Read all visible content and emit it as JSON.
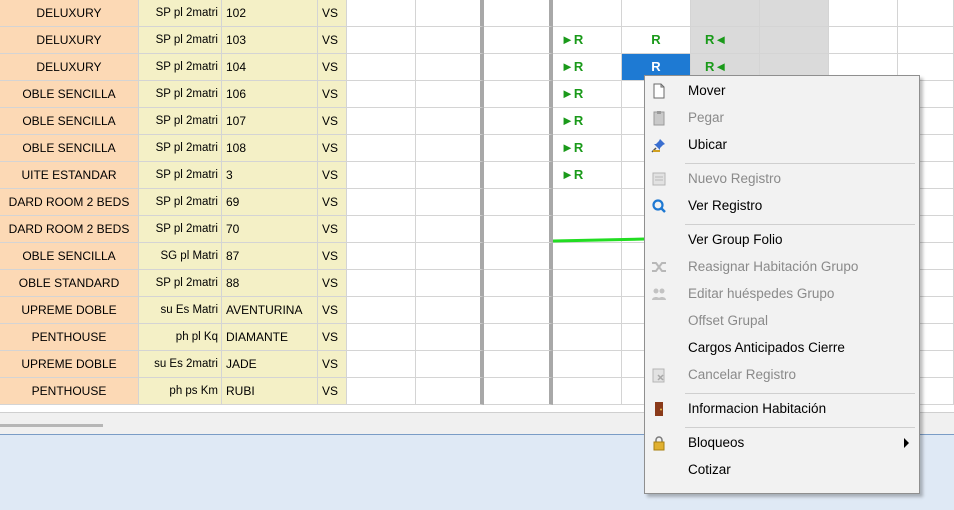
{
  "rows": [
    {
      "type": "DELUXURY",
      "plan": "SP pl 2matri",
      "room": "102",
      "status": "VS",
      "marks": []
    },
    {
      "type": "DELUXURY",
      "plan": "SP pl 2matri",
      "room": "103",
      "status": "VS",
      "marks": [
        {
          "col": 0,
          "text": "►R"
        },
        {
          "col": 1,
          "text": "R"
        },
        {
          "col": 2,
          "text": "R◄"
        }
      ]
    },
    {
      "type": "DELUXURY",
      "plan": "SP pl 2matri",
      "room": "104",
      "status": "VS",
      "marks": [
        {
          "col": 0,
          "text": "►R"
        },
        {
          "col": 1,
          "text": "R",
          "selected": true
        },
        {
          "col": 2,
          "text": "R◄"
        }
      ]
    },
    {
      "type": "OBLE SENCILLA",
      "plan": "SP pl 2matri",
      "room": "106",
      "status": "VS",
      "marks": [
        {
          "col": 0,
          "text": "►R"
        }
      ]
    },
    {
      "type": "OBLE SENCILLA",
      "plan": "SP pl 2matri",
      "room": "107",
      "status": "VS",
      "marks": [
        {
          "col": 0,
          "text": "►R"
        }
      ]
    },
    {
      "type": "OBLE SENCILLA",
      "plan": "SP pl 2matri",
      "room": "108",
      "status": "VS",
      "marks": [
        {
          "col": 0,
          "text": "►R"
        }
      ]
    },
    {
      "type": "UITE ESTANDAR",
      "plan": "SP pl 2matri",
      "room": "3",
      "status": "VS",
      "marks": [
        {
          "col": 0,
          "text": "►R"
        }
      ]
    },
    {
      "type": "DARD ROOM 2 BEDS",
      "plan": "SP pl 2matri",
      "room": "69",
      "status": "VS",
      "marks": []
    },
    {
      "type": "DARD ROOM 2 BEDS",
      "plan": "SP pl 2matri",
      "room": "70",
      "status": "VS",
      "marks": []
    },
    {
      "type": "OBLE SENCILLA",
      "plan": "SG pl Matri",
      "room": "87",
      "status": "VS",
      "marks": []
    },
    {
      "type": "OBLE STANDARD",
      "plan": "SP pl 2matri",
      "room": "88",
      "status": "VS",
      "marks": []
    },
    {
      "type": "UPREME DOBLE",
      "plan": "su Es Matri",
      "room": "AVENTURINA",
      "status": "VS",
      "marks": []
    },
    {
      "type": "PENTHOUSE",
      "plan": "ph pl Kq",
      "room": "DIAMANTE",
      "status": "VS",
      "marks": []
    },
    {
      "type": "UPREME DOBLE",
      "plan": "su Es 2matri",
      "room": "JADE",
      "status": "VS",
      "marks": []
    },
    {
      "type": "PENTHOUSE",
      "plan": "ph ps Km",
      "room": "RUBI",
      "status": "VS",
      "marks": []
    }
  ],
  "context_menu": [
    {
      "label": "Mover",
      "enabled": true,
      "icon": "page-icon"
    },
    {
      "label": "Pegar",
      "enabled": false,
      "icon": "clipboard-icon"
    },
    {
      "label": "Ubicar",
      "enabled": true,
      "icon": "pushpin-icon"
    },
    {
      "separator": true
    },
    {
      "label": "Nuevo Registro",
      "enabled": false,
      "icon": "form-icon"
    },
    {
      "label": "Ver Registro",
      "enabled": true,
      "icon": "magnifier-icon"
    },
    {
      "separator": true
    },
    {
      "label": "Ver Group Folio",
      "enabled": true,
      "icon": ""
    },
    {
      "label": "Reasignar Habitación Grupo",
      "enabled": false,
      "icon": "shuffle-icon"
    },
    {
      "label": "Editar huéspedes Grupo",
      "enabled": false,
      "icon": "group-icon"
    },
    {
      "label": "Offset Grupal",
      "enabled": false,
      "icon": ""
    },
    {
      "label": "Cargos Anticipados Cierre",
      "enabled": true,
      "icon": ""
    },
    {
      "label": "Cancelar Registro",
      "enabled": false,
      "icon": "cancel-form-icon"
    },
    {
      "separator": true
    },
    {
      "label": "Informacion Habitación",
      "enabled": true,
      "icon": "door-icon"
    },
    {
      "separator": true
    },
    {
      "label": "Bloqueos",
      "enabled": true,
      "icon": "padlock-icon",
      "submenu": true
    },
    {
      "label": "Cotizar",
      "enabled": true,
      "icon": ""
    }
  ],
  "colors": {
    "type_cell": "#fcd9b5",
    "info_cell": "#f4f0c6",
    "mark": "#1a9a1a",
    "selection": "#1e7ad3",
    "arrow": "#22dd22"
  }
}
